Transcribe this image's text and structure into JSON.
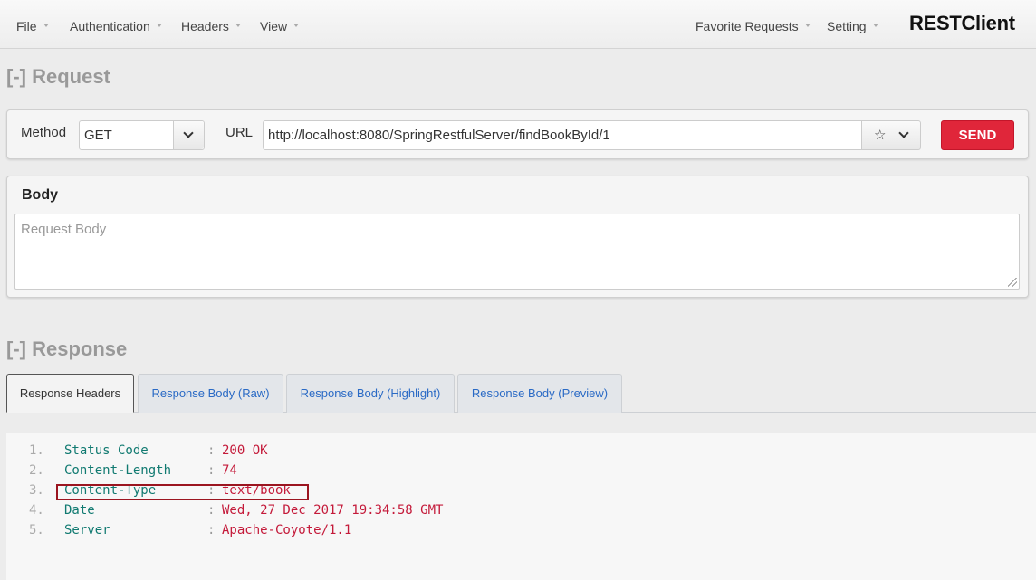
{
  "navbar": {
    "items": [
      {
        "label": "File"
      },
      {
        "label": "Authentication"
      },
      {
        "label": "Headers"
      },
      {
        "label": "View"
      }
    ],
    "right_items": [
      {
        "label": "Favorite Requests"
      },
      {
        "label": "Setting"
      }
    ],
    "brand": "RESTClient"
  },
  "request": {
    "section_title": "[-] Request",
    "method_label": "Method",
    "method_value": "GET",
    "url_label": "URL",
    "url_value": "http://localhost:8080/SpringRestfulServer/findBookById/1",
    "send_label": "SEND",
    "body_title": "Body",
    "body_placeholder": "Request Body"
  },
  "response": {
    "section_title": "[-] Response",
    "tabs": [
      {
        "label": "Response Headers",
        "active": true
      },
      {
        "label": "Response Body (Raw)",
        "active": false
      },
      {
        "label": "Response Body (Highlight)",
        "active": false
      },
      {
        "label": "Response Body (Preview)",
        "active": false
      }
    ],
    "headers": [
      {
        "line": "1.",
        "key": "Status Code",
        "value": "200 OK"
      },
      {
        "line": "2.",
        "key": "Content-Length",
        "value": "74"
      },
      {
        "line": "3.",
        "key": "Content-Type",
        "value": "text/book"
      },
      {
        "line": "4.",
        "key": "Date",
        "value": "Wed, 27 Dec 2017 19:34:58 GMT"
      },
      {
        "line": "5.",
        "key": "Server",
        "value": "Apache-Coyote/1.1"
      }
    ]
  },
  "colors": {
    "send_button": "#e0263a",
    "header_key": "#117a71",
    "header_value": "#c41a3a",
    "tab_link": "#2a6ac5",
    "highlight_box": "#9b1520"
  },
  "icons": [
    "chevron-down-icon",
    "star-icon",
    "caret-down-icon",
    "resize-grip-icon"
  ]
}
